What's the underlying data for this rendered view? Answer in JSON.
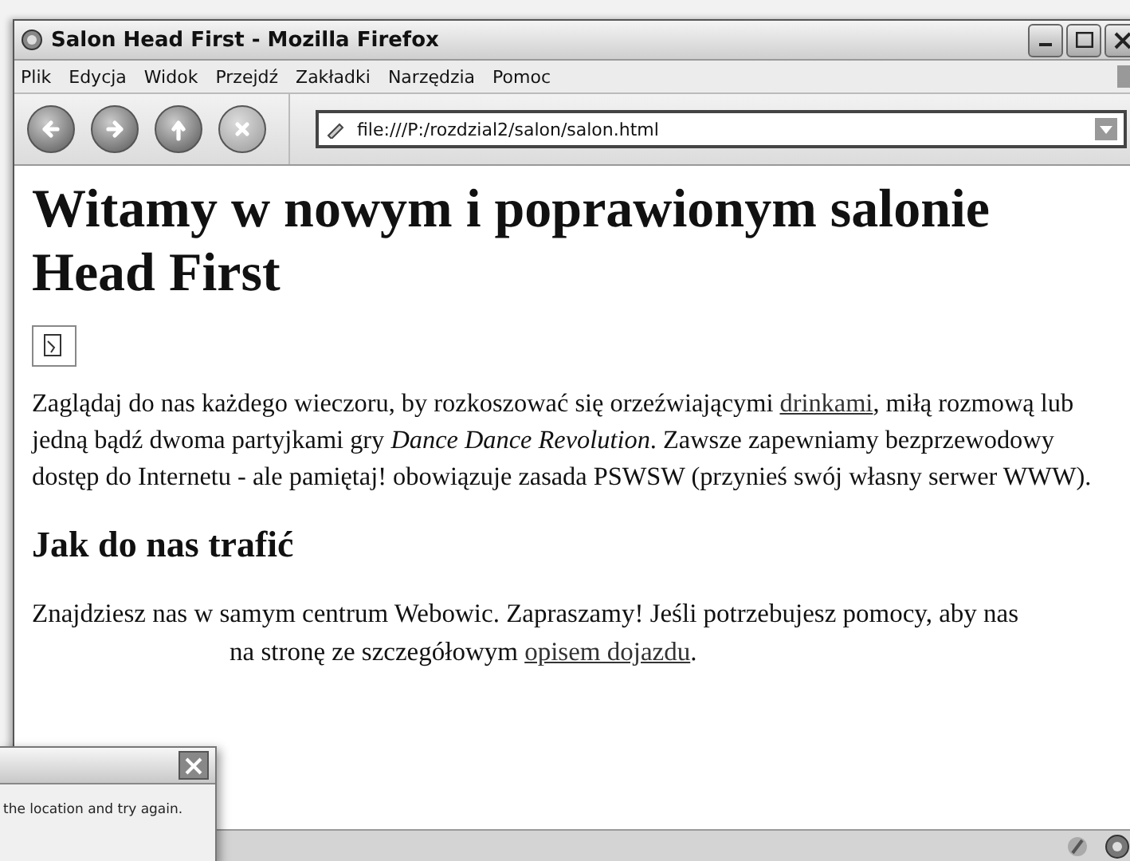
{
  "window": {
    "title": "Salon Head First - Mozilla Firefox"
  },
  "menu": [
    "Plik",
    "Edycja",
    "Widok",
    "Przejdź",
    "Zakładki",
    "Narzędzia",
    "Pomoc"
  ],
  "address": {
    "value": "file:///P:/rozdzial2/salon/salon.html"
  },
  "page": {
    "heading": "Witamy w nowym i poprawionym salonie Head First",
    "intro": [
      {
        "kind": "plain",
        "text": "Zaglądaj do nas każdego wieczoru, by rozkoszować się orzeźwiającymi "
      },
      {
        "kind": "link",
        "text": "drinkami"
      },
      {
        "kind": "plain",
        "text": ", miłą rozmową lub jedną bądź dwoma partyjkami gry "
      },
      {
        "kind": "italic",
        "text": "Dance Dance Revolution"
      },
      {
        "kind": "plain",
        "text": ". Zawsze zapewniamy bezprzewodowy dostęp do Internetu - ale pamiętaj! obowiązuje zasada PSWSW (przynieś swój własny serwer WWW)."
      }
    ],
    "subheading": "Jak do nas trafić",
    "directions_line": "Znajdziesz nas w samym centrum Webowic. Zapraszamy! Jeśli potrzebujesz pomocy, aby nas",
    "directions_rest": [
      {
        "kind": "plain",
        "text": "na stronę ze szczegółowym "
      },
      {
        "kind": "link",
        "text": "opisem dojazdu"
      },
      {
        "kind": "plain",
        "text": "."
      }
    ]
  },
  "dialog": {
    "message": "the location and try again."
  }
}
